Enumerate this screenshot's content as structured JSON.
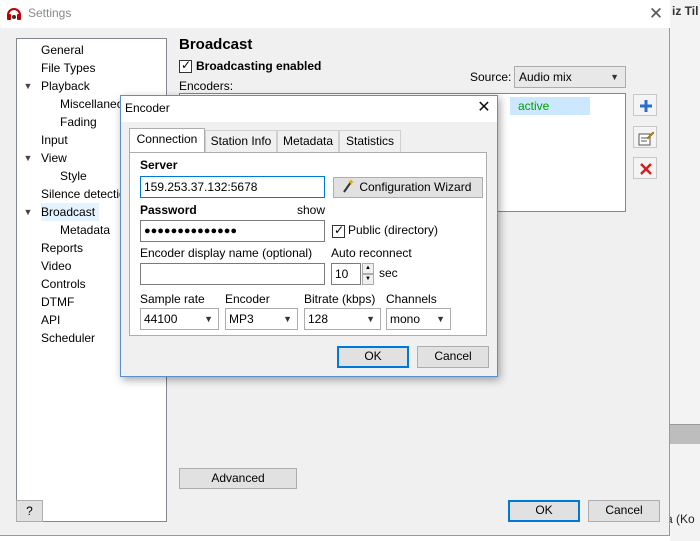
{
  "background": {
    "top_right_text": "iz Til",
    "bottom_right_text": "a (Ko"
  },
  "settings_window": {
    "title": "Settings",
    "close_glyph": "✕",
    "tree": [
      {
        "label": "General",
        "level": 1
      },
      {
        "label": "File Types",
        "level": 1
      },
      {
        "label": "Playback",
        "level": 0,
        "expanded": true
      },
      {
        "label": "Miscellaneous",
        "level": 2
      },
      {
        "label": "Fading",
        "level": 2
      },
      {
        "label": "Input",
        "level": 1
      },
      {
        "label": "View",
        "level": 0,
        "expanded": true
      },
      {
        "label": "Style",
        "level": 2
      },
      {
        "label": "Silence detection",
        "level": 1
      },
      {
        "label": "Broadcast",
        "level": 0,
        "expanded": true,
        "selected": true
      },
      {
        "label": "Metadata",
        "level": 2
      },
      {
        "label": "Reports",
        "level": 1
      },
      {
        "label": "Video",
        "level": 1
      },
      {
        "label": "Controls",
        "level": 1
      },
      {
        "label": "DTMF",
        "level": 1
      },
      {
        "label": "API",
        "level": 1
      },
      {
        "label": "Scheduler",
        "level": 1
      }
    ],
    "section_title": "Broadcast",
    "broadcasting_enabled_label": "Broadcasting enabled",
    "broadcasting_enabled": true,
    "encoders_label": "Encoders:",
    "source_label": "Source:",
    "source_value": "Audio mix",
    "encoder_row_status": "active",
    "advanced_button": "Advanced",
    "help_button": "?",
    "ok_button": "OK",
    "cancel_button": "Cancel"
  },
  "encoder_dialog": {
    "title": "Encoder",
    "close_glyph": "✕",
    "tabs": [
      "Connection",
      "Station Info",
      "Metadata",
      "Statistics"
    ],
    "active_tab": "Connection",
    "server_label": "Server",
    "server_value": "159.253.37.132:5678",
    "config_wizard_button": "Configuration Wizard",
    "password_label": "Password",
    "show_link": "show",
    "password_value": "●●●●●●●●●●●●●●",
    "public_label": "Public (directory)",
    "public_checked": true,
    "display_name_label": "Encoder display name (optional)",
    "display_name_value": "",
    "auto_reconnect_label": "Auto reconnect",
    "auto_reconnect_value": "10",
    "auto_reconnect_unit": "sec",
    "sample_rate_label": "Sample rate",
    "sample_rate_value": "44100",
    "encoder_label": "Encoder",
    "encoder_value": "MP3",
    "bitrate_label": "Bitrate (kbps)",
    "bitrate_value": "128",
    "channels_label": "Channels",
    "channels_value": "mono",
    "ok_button": "OK",
    "cancel_button": "Cancel"
  }
}
